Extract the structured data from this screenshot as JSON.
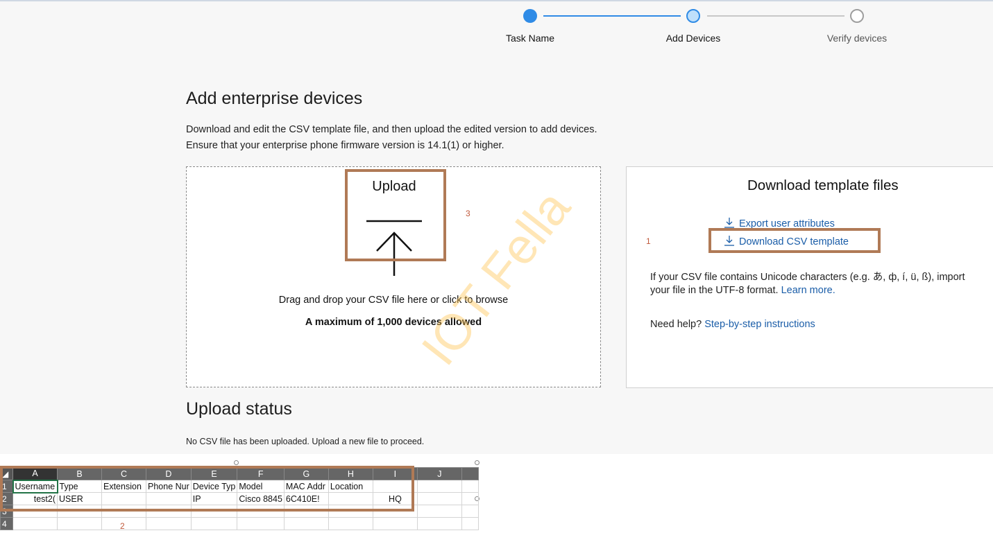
{
  "stepper": {
    "steps": [
      {
        "label": "Task Name",
        "state": "complete"
      },
      {
        "label": "Add Devices",
        "state": "current"
      },
      {
        "label": "Verify devices",
        "state": "pending"
      }
    ],
    "colors": {
      "active": "#2f8be6",
      "current_fill": "#bfe0fb",
      "pending": "#9e9e9e"
    }
  },
  "main": {
    "title": "Add enterprise devices",
    "desc_line1": "Download and edit the CSV template file, and then upload the edited version to add devices.",
    "desc_line2": "Ensure that your enterprise phone firmware version is 14.1(1) or higher."
  },
  "upload": {
    "label": "Upload",
    "drag_text": "Drag and drop your CSV file here or click to browse",
    "max_text": "A maximum of 1,000 devices allowed",
    "icon": "upload-arrow-icon"
  },
  "download": {
    "title": "Download template files",
    "export_link": "Export user attributes",
    "csv_link": "Download CSV template",
    "icon": "download-icon",
    "unicode_text1": "If your CSV file contains Unicode characters (e.g. あ, ф, í, ü, ß), import",
    "unicode_text2": "your file in the UTF-8 format.",
    "learn_more": "Learn more.",
    "help_text": "Need help?",
    "help_link": "Step-by-step instructions"
  },
  "status": {
    "title": "Upload status",
    "text": "No CSV file has been uploaded. Upload a new file to proceed."
  },
  "annotations": {
    "n1": "1",
    "n2": "2",
    "n3": "3",
    "color": "#b07a56"
  },
  "watermark": "IOT Fella",
  "sheet": {
    "columns": [
      "A",
      "B",
      "C",
      "D",
      "E",
      "F",
      "G",
      "H",
      "I",
      "J"
    ],
    "rows": [
      {
        "num": "1",
        "cells": [
          "Username",
          "Type",
          "Extension",
          "Phone Nur",
          "Device Typ",
          "Model",
          "MAC Addr",
          "Location",
          "",
          ""
        ]
      },
      {
        "num": "2",
        "cells": [
          "test2(",
          "USER",
          "",
          "",
          "IP",
          "Cisco 8845",
          "6C410E!",
          "",
          "HQ",
          ""
        ]
      },
      {
        "num": "3",
        "cells": [
          "",
          "",
          "",
          "",
          "",
          "",
          "",
          "",
          "",
          ""
        ]
      },
      {
        "num": "4",
        "cells": [
          "",
          "",
          "",
          "",
          "",
          "",
          "",
          "",
          "",
          ""
        ]
      }
    ]
  }
}
